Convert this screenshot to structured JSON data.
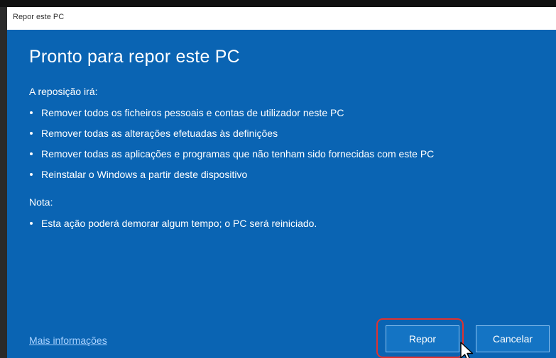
{
  "window": {
    "title": "Repor este PC"
  },
  "dialog": {
    "heading": "Pronto para repor este PC",
    "reset_section_label": "A reposição irá:",
    "reset_items": [
      "Remover todos os ficheiros pessoais e contas de utilizador neste PC",
      "Remover todas as alterações efetuadas às definições",
      "Remover todas as aplicações e programas que não tenham sido fornecidas com este PC",
      "Reinstalar o Windows a partir deste dispositivo"
    ],
    "note_label": "Nota:",
    "note_items": [
      "Esta ação poderá demorar algum tempo; o PC será reiniciado."
    ],
    "more_info_link": "Mais informações",
    "reset_button": "Repor",
    "cancel_button": "Cancelar"
  },
  "colors": {
    "dialog_background": "#0a64b3",
    "button_background": "#1474c4",
    "highlight_ring": "#e0322f"
  },
  "icons": {
    "cursor": "mouse-pointer-icon"
  }
}
